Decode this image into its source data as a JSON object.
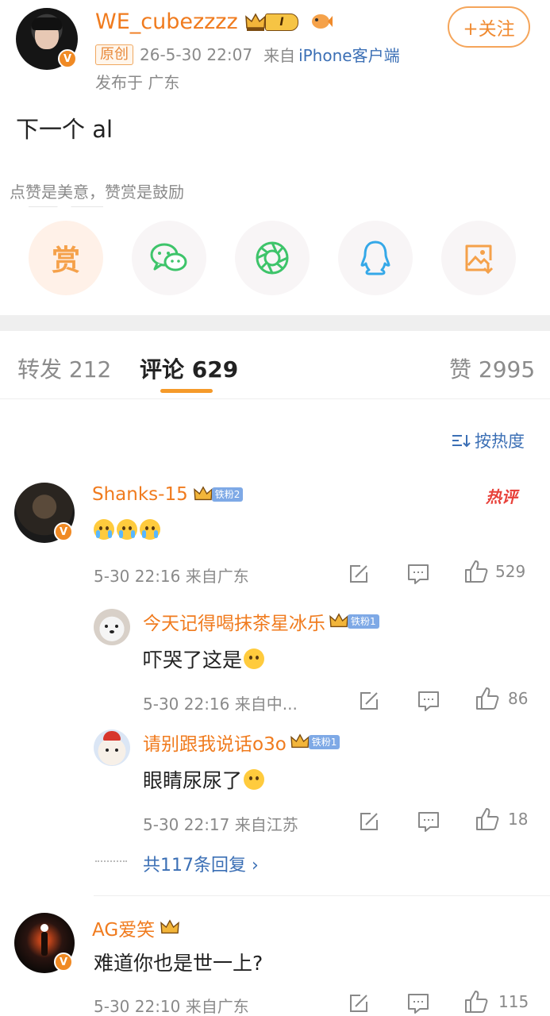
{
  "post": {
    "username": "WE_cubezzzz",
    "level_badge": "I",
    "original_tag": "原创",
    "timestamp": "26-5-30 22:07",
    "source_prefix": "来自",
    "source": "iPhone客户端",
    "location": "发布于 广东",
    "follow_label": "+关注",
    "content": "下一个 al"
  },
  "reward_prompt": "点赞是美意，赞赏是鼓励",
  "share": {
    "reward_char": "赏",
    "colors": {
      "reward": "#f5a14a",
      "wechat": "#3ec46a",
      "moments": "#3ec46a",
      "qq": "#35a8e8",
      "image": "#f5a14a"
    }
  },
  "tabs": {
    "repost": "转发 212",
    "comments": "评论 629",
    "likes": "赞 2995"
  },
  "sort_label": "按热度",
  "comments": [
    {
      "name": "Shanks-15",
      "fan": "铁粉2",
      "hot_tag": "热评",
      "text": "",
      "time": "5-30 22:16",
      "from": "来自广东",
      "likes": "529",
      "replies": [
        {
          "name": "今天记得喝抹茶星冰乐",
          "fan": "铁粉1",
          "text": "吓哭了这是",
          "time": "5-30 22:16",
          "from": "来自中...",
          "likes": "86"
        },
        {
          "name": "请别跟我说话o3o",
          "fan": "铁粉1",
          "text": "眼睛尿尿了",
          "time": "5-30 22:17",
          "from": "来自江苏",
          "likes": "18"
        }
      ],
      "more_replies": "共117条回复 ›"
    },
    {
      "name": "AG爱笑",
      "text": "难道你也是世一上?",
      "time": "5-30 22:10",
      "from": "来自广东",
      "likes": "115"
    }
  ]
}
